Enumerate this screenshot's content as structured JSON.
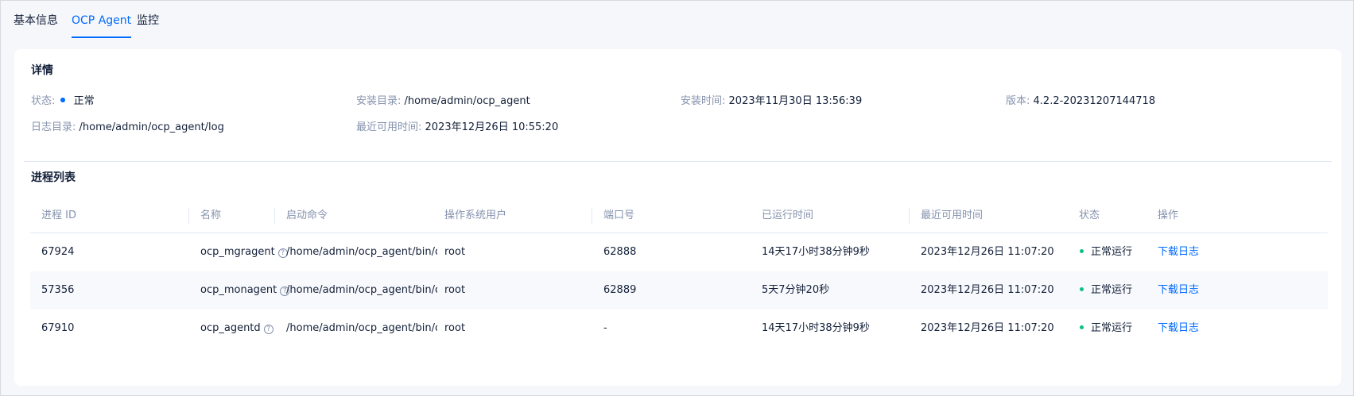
{
  "tabs": [
    {
      "label": "基本信息",
      "active": false
    },
    {
      "label": "OCP Agent",
      "active": true
    },
    {
      "label": "监控",
      "active": false
    }
  ],
  "details": {
    "title": "详情",
    "status_label": "状态:",
    "status_value": "正常",
    "install_dir_label": "安装目录:",
    "install_dir_value": "/home/admin/ocp_agent",
    "install_time_label": "安装时间:",
    "install_time_value": "2023年11月30日 13:56:39",
    "version_label": "版本:",
    "version_value": "4.2.2-20231207144718",
    "log_dir_label": "日志目录:",
    "log_dir_value": "/home/admin/ocp_agent/log",
    "last_available_label": "最近可用时间:",
    "last_available_value": "2023年12月26日 10:55:20"
  },
  "process_list": {
    "title": "进程列表",
    "columns": [
      "进程 ID",
      "名称",
      "启动命令",
      "操作系统用户",
      "端口号",
      "已运行时间",
      "最近可用时间",
      "状态",
      "操作"
    ],
    "rows": [
      {
        "pid": "67924",
        "name": "ocp_mgragent",
        "cmd": "/home/admin/ocp_agent/bin/o...",
        "user": "root",
        "port": "62888",
        "uptime": "14天17小时38分钟9秒",
        "last_available": "2023年12月26日 11:07:20",
        "status": "正常运行",
        "action": "下载日志"
      },
      {
        "pid": "57356",
        "name": "ocp_monagent",
        "cmd": "/home/admin/ocp_agent/bin/o...",
        "user": "root",
        "port": "62889",
        "uptime": "5天7分钟20秒",
        "last_available": "2023年12月26日 11:07:20",
        "status": "正常运行",
        "action": "下载日志"
      },
      {
        "pid": "67910",
        "name": "ocp_agentd",
        "cmd": "/home/admin/ocp_agent/bin/o...",
        "user": "root",
        "port": "-",
        "uptime": "14天17小时38分钟9秒",
        "last_available": "2023年12月26日 11:07:20",
        "status": "正常运行",
        "action": "下载日志"
      }
    ]
  },
  "colors": {
    "accent": "#006aff",
    "running": "#0ac185",
    "label": "#8592ad",
    "text": "#132039"
  }
}
